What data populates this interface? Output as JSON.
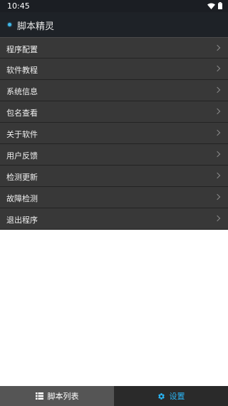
{
  "status_bar": {
    "time": "10:45"
  },
  "header": {
    "title": "脚本精灵",
    "accent_color": "#3fb7e8"
  },
  "menu": {
    "items": [
      {
        "label": "程序配置"
      },
      {
        "label": "软件教程"
      },
      {
        "label": "系统信息"
      },
      {
        "label": "包名查看"
      },
      {
        "label": "关于软件"
      },
      {
        "label": "用户反馈"
      },
      {
        "label": "检测更新"
      },
      {
        "label": "故障检测"
      },
      {
        "label": "退出程序"
      }
    ]
  },
  "bottom_nav": {
    "tabs": [
      {
        "label": "脚本列表",
        "icon": "list-icon",
        "active": false
      },
      {
        "label": "设置",
        "icon": "gear-icon",
        "active": true
      }
    ],
    "active_color": "#29b6f6"
  }
}
